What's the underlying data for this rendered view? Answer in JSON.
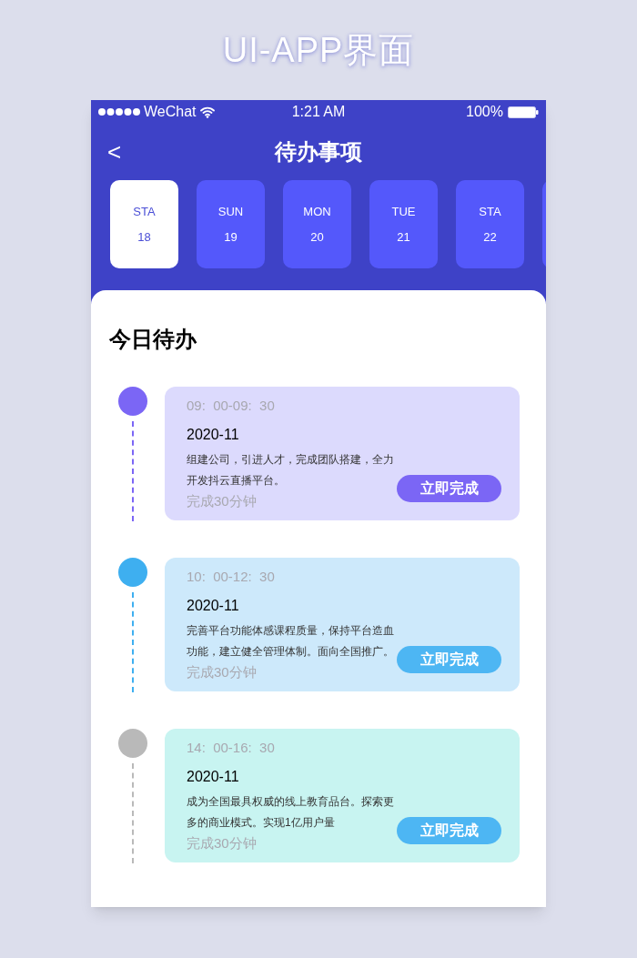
{
  "page_title": "UI-APP界面",
  "status_bar": {
    "carrier": "WeChat",
    "time": "1:21 AM",
    "battery": "100%"
  },
  "nav": {
    "back": "<",
    "title": "待办事项"
  },
  "days": [
    {
      "weekday": "STA",
      "date": "18",
      "selected": true
    },
    {
      "weekday": "SUN",
      "date": "19",
      "selected": false
    },
    {
      "weekday": "MON",
      "date": "20",
      "selected": false
    },
    {
      "weekday": "TUE",
      "date": "21",
      "selected": false
    },
    {
      "weekday": "STA",
      "date": "22",
      "selected": false
    }
  ],
  "section_title": "今日待办",
  "tasks": [
    {
      "time": "09:  00-09:  30",
      "date": "2020-11",
      "description": "组建公司，引进人才，完成团队搭建，全力开发抖云直播平台。",
      "duration": "完成30分钟",
      "button": "立即完成",
      "color": "#7b66f5",
      "kind": "violet"
    },
    {
      "time": "10:  00-12:  30",
      "date": "2020-11",
      "description": "完善平台功能体感课程质量，保持平台造血功能，建立健全管理体制。面向全国推广。",
      "duration": "完成30分钟",
      "button": "立即完成",
      "color": "#3eaff0",
      "kind": "blue"
    },
    {
      "time": "14:  00-16:  30",
      "date": "2020-11",
      "description": "成为全国最具权威的线上教育品台。探索更多的商业模式。实现1亿用户量",
      "duration": "完成30分钟",
      "button": "立即完成",
      "color": "#b9b9b9",
      "kind": "teal"
    }
  ]
}
